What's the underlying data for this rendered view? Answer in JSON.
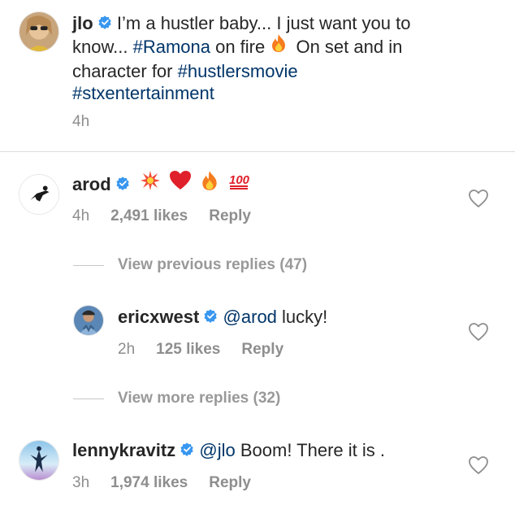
{
  "post": {
    "username": "jlo",
    "caption_parts": [
      {
        "text": "I’m a hustler baby... I just want you to know... ",
        "tag": false
      },
      {
        "text": "#Ramona",
        "tag": true
      },
      {
        "text": " on fire ",
        "tag": false
      },
      {
        "emoji": "fire"
      },
      {
        "text": " On set and in character for ",
        "tag": false
      },
      {
        "text": "#hustlersmovie",
        "tag": true
      },
      {
        "text": " ",
        "tag": false
      },
      {
        "text": "#stxentertainment",
        "tag": true
      }
    ],
    "time": "4h"
  },
  "comments": [
    {
      "username": "arod",
      "emojis": [
        "collision-icon",
        "red-heart-icon",
        "fire-icon",
        "hundred-points-icon"
      ],
      "time": "4h",
      "likes": "2,491 likes",
      "reply": "Reply"
    }
  ],
  "thread1": {
    "view_label": "View previous replies (47)"
  },
  "reply1": {
    "username": "ericxwest",
    "mention": "@arod",
    "text": " lucky!",
    "time": "2h",
    "likes": "125 likes",
    "reply": "Reply"
  },
  "thread2": {
    "view_label": "View more replies (32)"
  },
  "comment2": {
    "username": "lennykravitz",
    "mention": "@jlo",
    "text": " Boom! There it is .",
    "time": "3h",
    "likes": "1,974 likes",
    "reply": "Reply"
  },
  "colors": {
    "verified": "#3897f0",
    "hashtag": "#003569",
    "muted": "#8e8e8e"
  }
}
